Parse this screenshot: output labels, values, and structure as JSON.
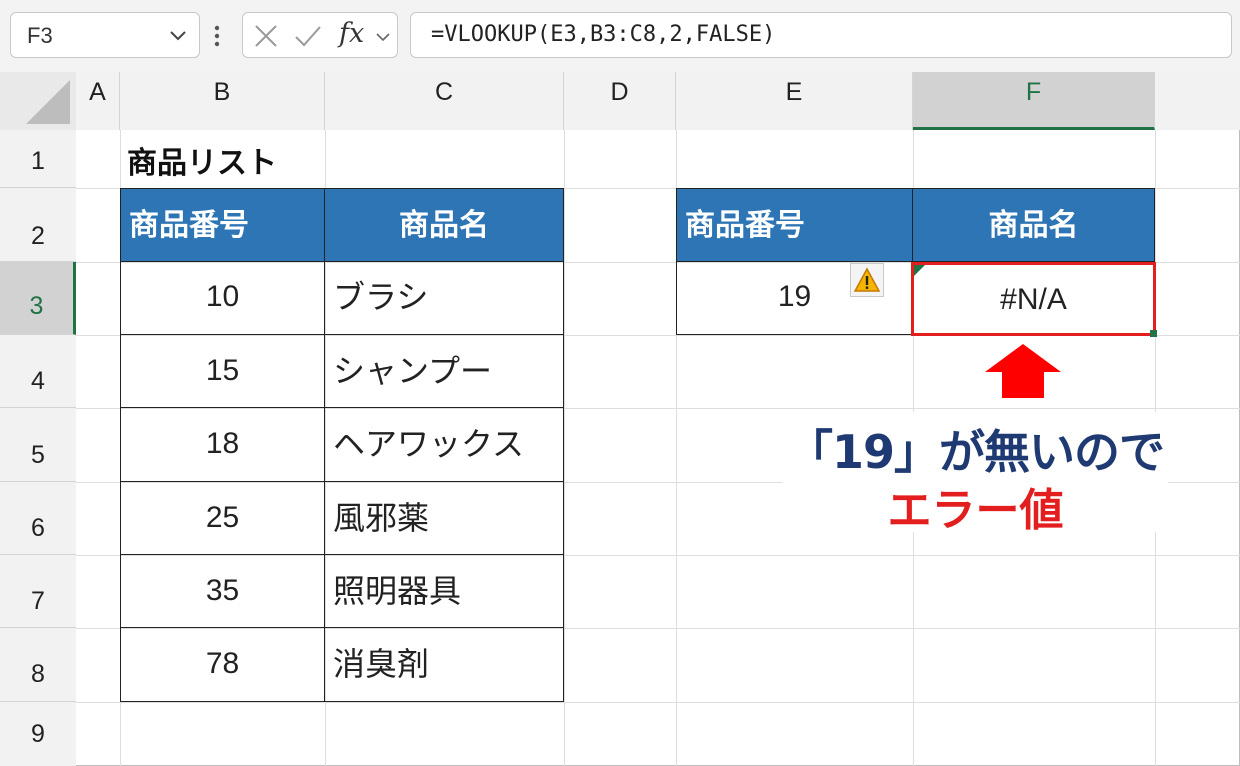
{
  "formula_bar": {
    "name_box": "F3",
    "fx_label": "fx",
    "formula": "=VLOOKUP(E3,B3:C8,2,FALSE)"
  },
  "columns": [
    "A",
    "B",
    "C",
    "D",
    "E",
    "F"
  ],
  "rows": [
    "1",
    "2",
    "3",
    "4",
    "5",
    "6",
    "7",
    "8",
    "9"
  ],
  "sheet": {
    "title": "商品リスト",
    "product_list": {
      "headers": [
        "商品番号",
        "商品名"
      ],
      "rows": [
        {
          "code": "10",
          "name": "ブラシ"
        },
        {
          "code": "15",
          "name": "シャンプー"
        },
        {
          "code": "18",
          "name": "ヘアワックス"
        },
        {
          "code": "25",
          "name": "風邪薬"
        },
        {
          "code": "35",
          "name": "照明器具"
        },
        {
          "code": "78",
          "name": "消臭剤"
        }
      ]
    },
    "lookup": {
      "headers": [
        "商品番号",
        "商品名"
      ],
      "code": "19",
      "result": "#N/A"
    }
  },
  "callout": {
    "line1": "「19」が無いので",
    "line2": "エラー値"
  },
  "colors": {
    "header_fill": "#2e75b6",
    "selection_green": "#217346",
    "error_highlight": "#e31e1e",
    "callout_text": "#1f3a73"
  },
  "icons": [
    "chevron-down-icon",
    "more-options-icon",
    "cancel-icon",
    "enter-icon",
    "warning-icon",
    "arrow-up-icon"
  ]
}
